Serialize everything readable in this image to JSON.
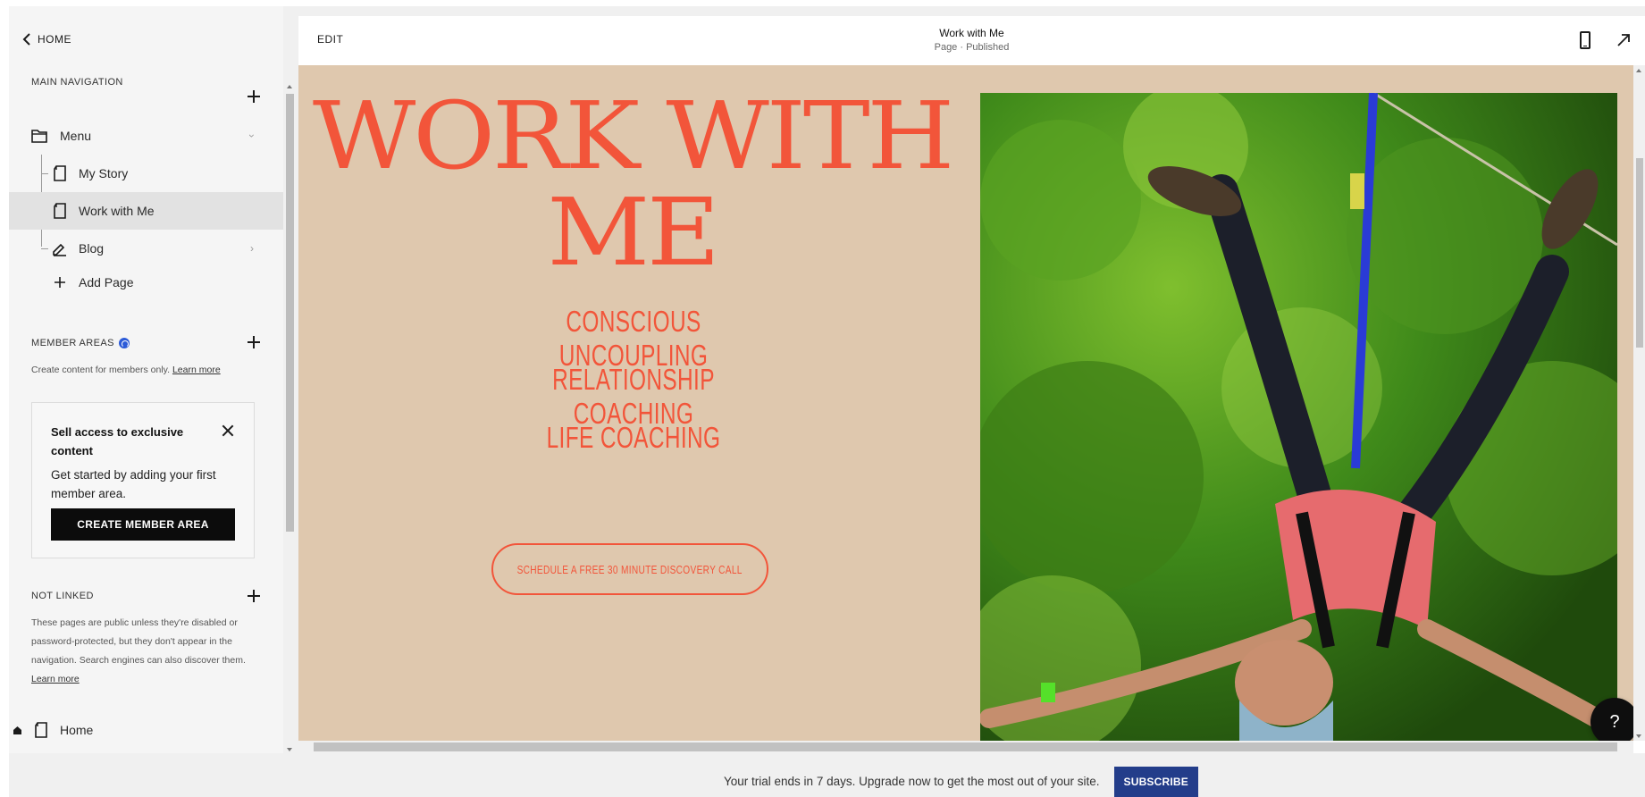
{
  "sidebar": {
    "home_label": "HOME",
    "main_nav_title": "MAIN NAVIGATION",
    "items": [
      {
        "label": "Menu",
        "icon": "folder-icon"
      },
      {
        "label": "My Story",
        "icon": "page-icon"
      },
      {
        "label": "Work with Me",
        "icon": "page-icon"
      },
      {
        "label": "Blog",
        "icon": "blog-icon"
      },
      {
        "label": "Add Page",
        "icon": "plus-icon"
      }
    ],
    "member_areas_title": "MEMBER AREAS",
    "member_desc": "Create content for members only.",
    "member_learn_more": "Learn more",
    "promo": {
      "title": "Sell access to exclusive content",
      "body": "Get started by adding your first member area.",
      "button": "CREATE MEMBER AREA"
    },
    "not_linked_title": "NOT LINKED",
    "not_linked_desc": "These pages are public unless they're disabled or password-protected, but they don't appear in the navigation. Search engines can also discover them.",
    "not_linked_learn_more": "Learn more",
    "home_page_label": "Home"
  },
  "header": {
    "edit_label": "EDIT",
    "page_title": "Work with Me",
    "page_status": "Page · Published"
  },
  "canvas": {
    "headline": "WORK WITH ME",
    "services": [
      "CONSCIOUS UNCOUPLING",
      "RELATIONSHIP COACHING",
      "LIFE COACHING"
    ],
    "cta_label": "SCHEDULE A FREE 30 MINUTE DISCOVERY CALL",
    "help_label": "?"
  },
  "trial": {
    "text": "Your trial ends in 7 days. Upgrade now to get the most out of your site.",
    "button": "SUBSCRIBE"
  },
  "colors": {
    "accent_orange": "#f2553a",
    "canvas_bg": "#dfc8ae",
    "subscribe_blue": "#233d8a",
    "member_badge": "#2c5bd8"
  }
}
